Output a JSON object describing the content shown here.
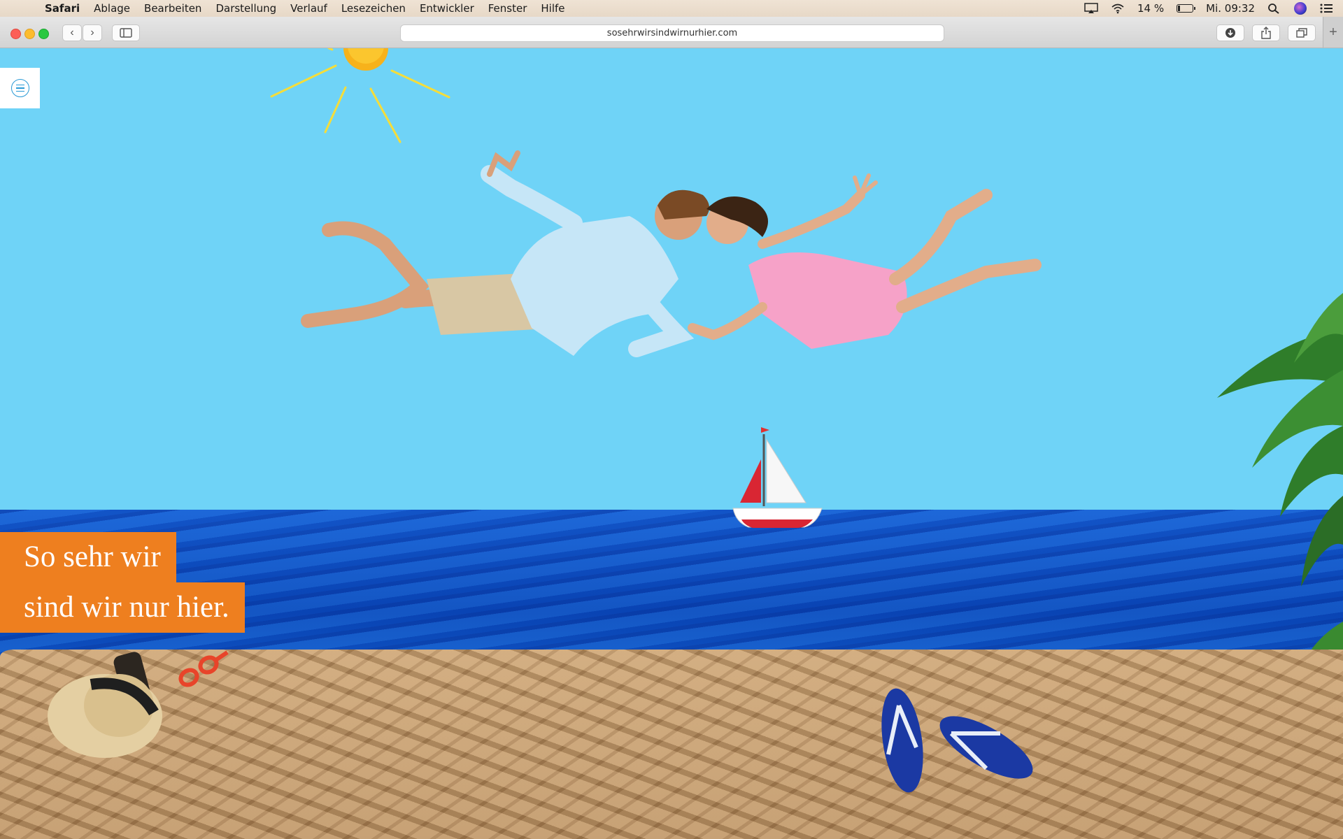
{
  "menubar": {
    "app_name": "Safari",
    "items": [
      "Ablage",
      "Bearbeiten",
      "Darstellung",
      "Verlauf",
      "Lesezeichen",
      "Entwickler",
      "Fenster",
      "Hilfe"
    ],
    "battery_percent": "14 %",
    "battery_level": 0.14,
    "clock": "Mi. 09:32",
    "icons": [
      "apple-icon",
      "airplay-icon",
      "wifi-icon",
      "battery-icon",
      "spotlight-search-icon",
      "siri-icon",
      "notification-center-icon"
    ]
  },
  "browser": {
    "url": "sosehrwirsindwirnurhier.com",
    "buttons": {
      "back": "‹",
      "forward": "›",
      "new_tab": "+"
    }
  },
  "page": {
    "headline_line1": "So sehr wir",
    "headline_line2": "sind wir nur hier.",
    "colors": {
      "sky": "#6fd3f7",
      "headline_bg": "#ee7f1f",
      "sea": "#0d47b8",
      "sand": "#b48b60"
    }
  }
}
